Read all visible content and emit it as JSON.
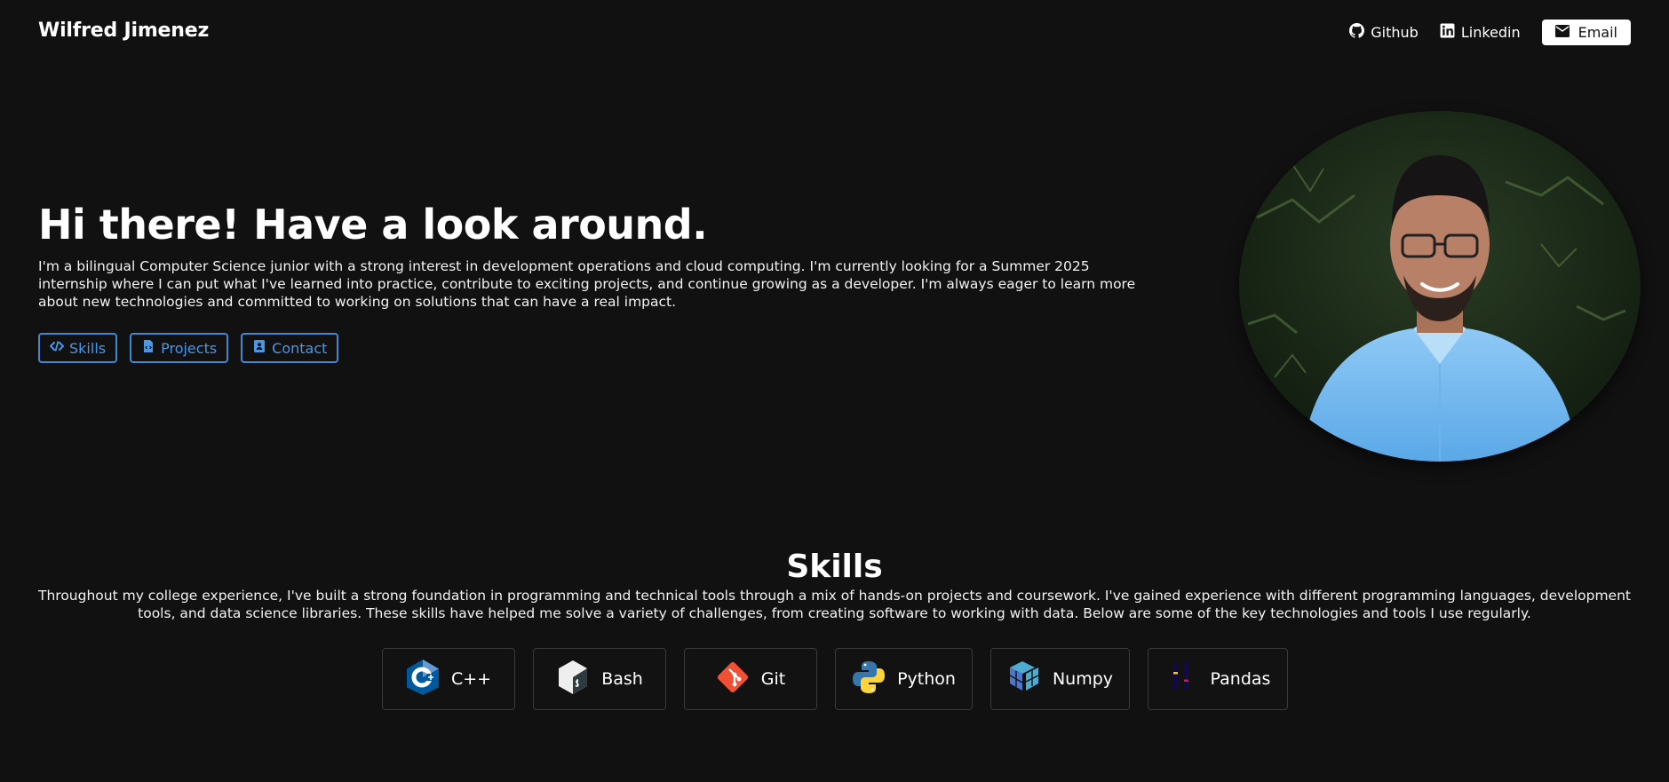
{
  "header": {
    "brand": "Wilfred Jimenez",
    "nav": {
      "github": "Github",
      "linkedin": "Linkedin",
      "email": "Email"
    }
  },
  "hero": {
    "title": "Hi there! Have a look around.",
    "body": "I'm a bilingual Computer Science junior with a strong interest in development operations and cloud computing. I'm currently looking for a Summer 2025 internship where I can put what I've learned into practice, contribute to exciting projects, and continue growing as a developer. I'm always eager to learn more about new technologies and committed to working on solutions that can have a real impact.",
    "buttons": {
      "skills": "Skills",
      "projects": "Projects",
      "contact": "Contact"
    },
    "accent_color": "#3f88d6"
  },
  "skills": {
    "title": "Skills",
    "body": "Throughout my college experience, I've built a strong foundation in programming and technical tools through a mix of hands-on projects and coursework. I've gained experience with different programming languages, development tools, and data science libraries. These skills have helped me solve a variety of challenges, from creating software to working with data. Below are some of the key technologies and tools I use regularly.",
    "items": [
      {
        "label": "C++",
        "icon": "cpp-icon"
      },
      {
        "label": "Bash",
        "icon": "bash-icon"
      },
      {
        "label": "Git",
        "icon": "git-icon"
      },
      {
        "label": "Python",
        "icon": "python-icon"
      },
      {
        "label": "Numpy",
        "icon": "numpy-icon"
      },
      {
        "label": "Pandas",
        "icon": "pandas-icon"
      }
    ]
  }
}
